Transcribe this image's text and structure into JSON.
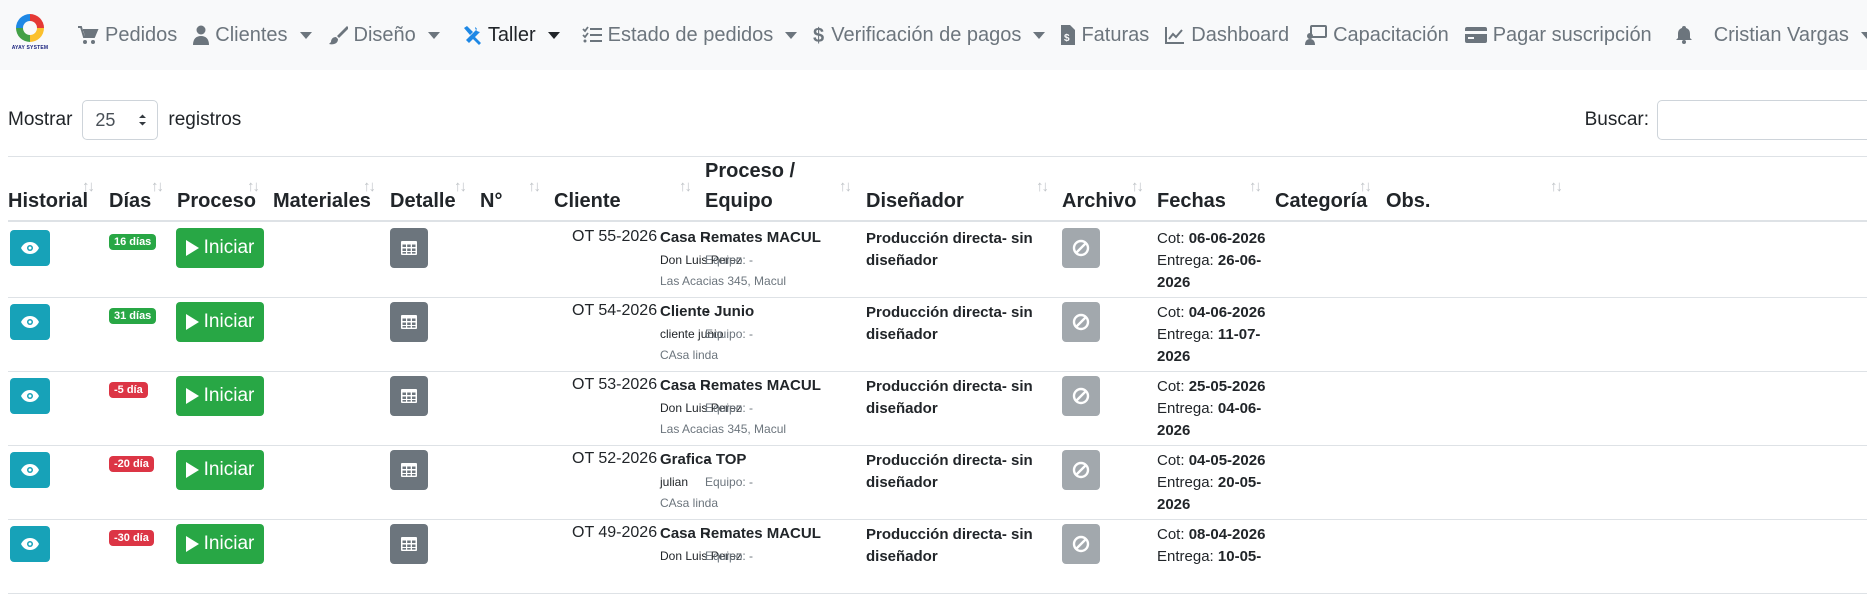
{
  "brand": {
    "logo_text": "AYAY SYSTEM"
  },
  "nav": [
    {
      "label": "Pedidos",
      "icon": "cart-icon",
      "dropdown": false,
      "active": false
    },
    {
      "label": "Clientes",
      "icon": "user-icon",
      "dropdown": true,
      "active": false
    },
    {
      "label": "Diseño",
      "icon": "paintbrush-icon",
      "dropdown": true,
      "active": false
    },
    {
      "label": "Taller",
      "icon": "tools-icon",
      "dropdown": true,
      "active": true
    },
    {
      "label": "Estado de pedidos",
      "icon": "list-check-icon",
      "dropdown": true,
      "active": false
    },
    {
      "label": "Verificación de pagos",
      "icon": "dollar-icon",
      "dropdown": true,
      "active": false
    },
    {
      "label": "Faturas",
      "icon": "invoice-icon",
      "dropdown": false,
      "active": false
    },
    {
      "label": "Dashboard",
      "icon": "chart-line-icon",
      "dropdown": false,
      "active": false
    },
    {
      "label": "Capacitación",
      "icon": "teacher-icon",
      "dropdown": false,
      "active": false
    },
    {
      "label": "Pagar suscripción",
      "icon": "credit-card-icon",
      "dropdown": false,
      "active": false
    },
    {
      "label": "",
      "icon": "bell-icon",
      "dropdown": false,
      "active": false
    },
    {
      "label": "Cristian Vargas",
      "icon": "",
      "dropdown": true,
      "active": false
    }
  ],
  "controls": {
    "show_label": "Mostrar",
    "page_size": "25",
    "records_label": "registros",
    "search_label": "Buscar:"
  },
  "columns": [
    "Historial",
    "Días",
    "Proceso",
    "Materiales",
    "Detalle",
    "N°",
    "Cliente",
    "Proceso /\nEquipo",
    "Diseñador",
    "Archivo",
    "Fechas",
    "Categoría",
    "Obs."
  ],
  "rows": [
    {
      "days": "16 días",
      "days_status": "green",
      "start_label": "Iniciar",
      "ot": "OT 55-2026",
      "client": "Casa Remates MACUL",
      "contact": "Don Luis Perez",
      "address": "Las Acacias 345, Macul",
      "process": "-",
      "equipo": "Equipo: -",
      "designer": "Producción directa- sin diseñador",
      "cot_label": "Cot:",
      "cot": "06-06-2026",
      "entrega_label": "Entrega:",
      "entrega": "26-06-2026"
    },
    {
      "days": "31 días",
      "days_status": "green",
      "start_label": "Iniciar",
      "ot": "OT 54-2026",
      "client": "Cliente Junio",
      "contact": "cliente junio",
      "address": "CAsa linda",
      "process": "-",
      "equipo": "Equipo: -",
      "designer": "Producción directa- sin diseñador",
      "cot_label": "Cot:",
      "cot": "04-06-2026",
      "entrega_label": "Entrega:",
      "entrega": "11-07-2026"
    },
    {
      "days": "-5 día",
      "days_status": "red",
      "start_label": "Iniciar",
      "ot": "OT 53-2026",
      "client": "Casa Remates MACUL",
      "contact": "Don Luis Perez",
      "address": "Las Acacias 345, Macul",
      "process": "-",
      "equipo": "Equipo: -",
      "designer": "Producción directa- sin diseñador",
      "cot_label": "Cot:",
      "cot": "25-05-2026",
      "entrega_label": "Entrega:",
      "entrega": "04-06-2026"
    },
    {
      "days": "-20 día",
      "days_status": "red",
      "start_label": "Iniciar",
      "ot": "OT 52-2026",
      "client": "Grafica TOP",
      "contact": "julian",
      "address": "CAsa linda",
      "process": "-",
      "equipo": "Equipo: -",
      "designer": "Producción directa- sin diseñador",
      "cot_label": "Cot:",
      "cot": "04-05-2026",
      "entrega_label": "Entrega:",
      "entrega": "20-05-2026"
    },
    {
      "days": "-30 día",
      "days_status": "red",
      "start_label": "Iniciar",
      "ot": "OT 49-2026",
      "client": "Casa Remates MACUL",
      "contact": "Don Luis Perez",
      "address": "",
      "process": "-",
      "equipo": "Equipo: -",
      "designer": "Producción directa- sin diseñador",
      "cot_label": "Cot:",
      "cot": "08-04-2026",
      "entrega_label": "Entrega:",
      "entrega": "10-05-"
    }
  ],
  "colors": {
    "info": "#17a2b8",
    "success": "#28a745",
    "danger": "#dc3545",
    "secondary": "#6c757d"
  }
}
